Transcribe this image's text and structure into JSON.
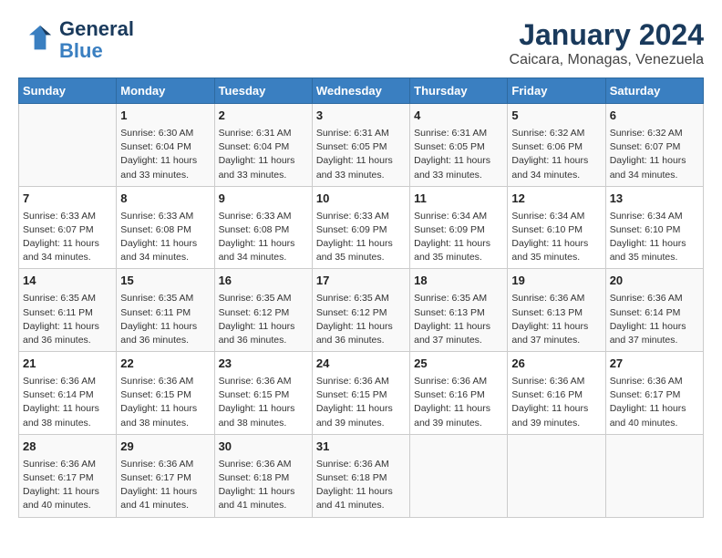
{
  "header": {
    "logo_line1": "General",
    "logo_line2": "Blue",
    "title": "January 2024",
    "subtitle": "Caicara, Monagas, Venezuela"
  },
  "columns": [
    "Sunday",
    "Monday",
    "Tuesday",
    "Wednesday",
    "Thursday",
    "Friday",
    "Saturday"
  ],
  "weeks": [
    [
      {
        "day": "",
        "info": ""
      },
      {
        "day": "1",
        "info": "Sunrise: 6:30 AM\nSunset: 6:04 PM\nDaylight: 11 hours\nand 33 minutes."
      },
      {
        "day": "2",
        "info": "Sunrise: 6:31 AM\nSunset: 6:04 PM\nDaylight: 11 hours\nand 33 minutes."
      },
      {
        "day": "3",
        "info": "Sunrise: 6:31 AM\nSunset: 6:05 PM\nDaylight: 11 hours\nand 33 minutes."
      },
      {
        "day": "4",
        "info": "Sunrise: 6:31 AM\nSunset: 6:05 PM\nDaylight: 11 hours\nand 33 minutes."
      },
      {
        "day": "5",
        "info": "Sunrise: 6:32 AM\nSunset: 6:06 PM\nDaylight: 11 hours\nand 34 minutes."
      },
      {
        "day": "6",
        "info": "Sunrise: 6:32 AM\nSunset: 6:07 PM\nDaylight: 11 hours\nand 34 minutes."
      }
    ],
    [
      {
        "day": "7",
        "info": "Sunrise: 6:33 AM\nSunset: 6:07 PM\nDaylight: 11 hours\nand 34 minutes."
      },
      {
        "day": "8",
        "info": "Sunrise: 6:33 AM\nSunset: 6:08 PM\nDaylight: 11 hours\nand 34 minutes."
      },
      {
        "day": "9",
        "info": "Sunrise: 6:33 AM\nSunset: 6:08 PM\nDaylight: 11 hours\nand 34 minutes."
      },
      {
        "day": "10",
        "info": "Sunrise: 6:33 AM\nSunset: 6:09 PM\nDaylight: 11 hours\nand 35 minutes."
      },
      {
        "day": "11",
        "info": "Sunrise: 6:34 AM\nSunset: 6:09 PM\nDaylight: 11 hours\nand 35 minutes."
      },
      {
        "day": "12",
        "info": "Sunrise: 6:34 AM\nSunset: 6:10 PM\nDaylight: 11 hours\nand 35 minutes."
      },
      {
        "day": "13",
        "info": "Sunrise: 6:34 AM\nSunset: 6:10 PM\nDaylight: 11 hours\nand 35 minutes."
      }
    ],
    [
      {
        "day": "14",
        "info": "Sunrise: 6:35 AM\nSunset: 6:11 PM\nDaylight: 11 hours\nand 36 minutes."
      },
      {
        "day": "15",
        "info": "Sunrise: 6:35 AM\nSunset: 6:11 PM\nDaylight: 11 hours\nand 36 minutes."
      },
      {
        "day": "16",
        "info": "Sunrise: 6:35 AM\nSunset: 6:12 PM\nDaylight: 11 hours\nand 36 minutes."
      },
      {
        "day": "17",
        "info": "Sunrise: 6:35 AM\nSunset: 6:12 PM\nDaylight: 11 hours\nand 36 minutes."
      },
      {
        "day": "18",
        "info": "Sunrise: 6:35 AM\nSunset: 6:13 PM\nDaylight: 11 hours\nand 37 minutes."
      },
      {
        "day": "19",
        "info": "Sunrise: 6:36 AM\nSunset: 6:13 PM\nDaylight: 11 hours\nand 37 minutes."
      },
      {
        "day": "20",
        "info": "Sunrise: 6:36 AM\nSunset: 6:14 PM\nDaylight: 11 hours\nand 37 minutes."
      }
    ],
    [
      {
        "day": "21",
        "info": "Sunrise: 6:36 AM\nSunset: 6:14 PM\nDaylight: 11 hours\nand 38 minutes."
      },
      {
        "day": "22",
        "info": "Sunrise: 6:36 AM\nSunset: 6:15 PM\nDaylight: 11 hours\nand 38 minutes."
      },
      {
        "day": "23",
        "info": "Sunrise: 6:36 AM\nSunset: 6:15 PM\nDaylight: 11 hours\nand 38 minutes."
      },
      {
        "day": "24",
        "info": "Sunrise: 6:36 AM\nSunset: 6:15 PM\nDaylight: 11 hours\nand 39 minutes."
      },
      {
        "day": "25",
        "info": "Sunrise: 6:36 AM\nSunset: 6:16 PM\nDaylight: 11 hours\nand 39 minutes."
      },
      {
        "day": "26",
        "info": "Sunrise: 6:36 AM\nSunset: 6:16 PM\nDaylight: 11 hours\nand 39 minutes."
      },
      {
        "day": "27",
        "info": "Sunrise: 6:36 AM\nSunset: 6:17 PM\nDaylight: 11 hours\nand 40 minutes."
      }
    ],
    [
      {
        "day": "28",
        "info": "Sunrise: 6:36 AM\nSunset: 6:17 PM\nDaylight: 11 hours\nand 40 minutes."
      },
      {
        "day": "29",
        "info": "Sunrise: 6:36 AM\nSunset: 6:17 PM\nDaylight: 11 hours\nand 41 minutes."
      },
      {
        "day": "30",
        "info": "Sunrise: 6:36 AM\nSunset: 6:18 PM\nDaylight: 11 hours\nand 41 minutes."
      },
      {
        "day": "31",
        "info": "Sunrise: 6:36 AM\nSunset: 6:18 PM\nDaylight: 11 hours\nand 41 minutes."
      },
      {
        "day": "",
        "info": ""
      },
      {
        "day": "",
        "info": ""
      },
      {
        "day": "",
        "info": ""
      }
    ]
  ]
}
